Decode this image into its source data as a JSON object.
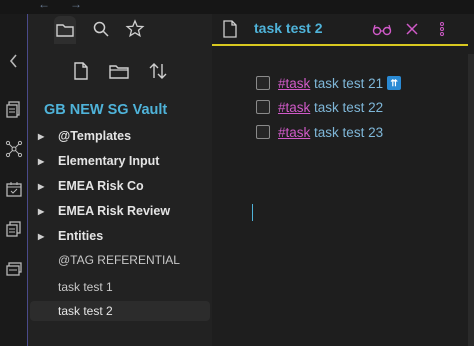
{
  "nav": {
    "back_icon": "arrow-left-icon",
    "forward_icon": "arrow-right-icon",
    "back_glyph": "←",
    "forward_glyph": "→"
  },
  "ribbon": {
    "icons": [
      "collapse-sidebar-icon",
      "files-icon",
      "graph-icon",
      "calendar-icon",
      "copy-icon",
      "slides-icon"
    ]
  },
  "sidebar": {
    "tabs": [
      "folder-icon",
      "search-icon",
      "star-icon"
    ],
    "actions": [
      "new-note-icon",
      "new-folder-icon",
      "sort-icon"
    ],
    "vault_name": "GB NEW SG Vault",
    "folders": [
      {
        "label": "@Templates"
      },
      {
        "label": "Elementary Input"
      },
      {
        "label": "EMEA Risk Co"
      },
      {
        "label": "EMEA Risk Review"
      },
      {
        "label": "Entities"
      }
    ],
    "files": [
      {
        "label": "@TAG REFERENTIAL"
      },
      {
        "label": "task test 1"
      },
      {
        "label": "task test 2"
      }
    ],
    "active_file": "task test 2"
  },
  "editor": {
    "title": "task test 2",
    "header_icons": [
      "glasses-icon",
      "close-icon",
      "more-icon"
    ],
    "accent_color": "#d8c820",
    "tasks": [
      {
        "tag": "#task",
        "text": "task test 21",
        "priority_glyph": "⇈"
      },
      {
        "tag": "#task",
        "text": "task test 22"
      },
      {
        "tag": "#task",
        "text": "task test 23"
      }
    ]
  },
  "colors": {
    "link": "#4fb3d9",
    "tag": "#d05ac8",
    "background": "#1e1e1e",
    "sidebar": "#222222"
  }
}
